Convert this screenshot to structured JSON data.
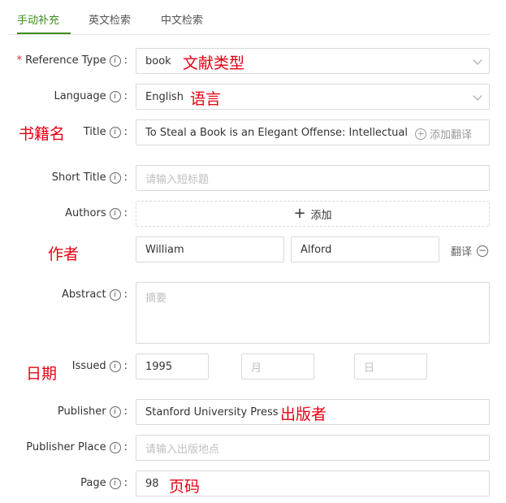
{
  "tabs": [
    {
      "label": "手动补充",
      "active": true
    },
    {
      "label": "英文检索",
      "active": false
    },
    {
      "label": "中文检索",
      "active": false
    }
  ],
  "fields": {
    "reference_type": {
      "label": "Reference Type",
      "value": "book"
    },
    "language": {
      "label": "Language",
      "value": "English"
    },
    "title": {
      "label": "Title",
      "value": "To Steal a Book is an Elegant Offense: Intellectual Pro",
      "add_translation": "添加翻译"
    },
    "short_title": {
      "label": "Short Title",
      "placeholder": "请输入短标题"
    },
    "authors": {
      "label": "Authors",
      "add_label": "添加",
      "first": "William",
      "last": "Alford",
      "translate": "翻译"
    },
    "abstract": {
      "label": "Abstract",
      "placeholder": "摘要"
    },
    "issued": {
      "label": "Issued",
      "year": "1995",
      "month_placeholder": "月",
      "day_placeholder": "日"
    },
    "publisher": {
      "label": "Publisher",
      "value": "Stanford University Press"
    },
    "publisher_place": {
      "label": "Publisher Place",
      "placeholder": "请输入出版地点"
    },
    "page": {
      "label": "Page",
      "value": "98"
    }
  },
  "annotations": {
    "doc_type": "文献类型",
    "language": "语言",
    "title": "书籍名",
    "author": "作者",
    "date": "日期",
    "publisher": "出版者",
    "page": "页码"
  },
  "colors": {
    "accent": "#3a8e1a",
    "annotation": "#e60012",
    "required": "#f5222d"
  },
  "icons": {
    "info": "info-circle-icon",
    "dropdown": "chevron-down-icon",
    "add": "plus-icon",
    "remove": "minus-circle-icon"
  }
}
